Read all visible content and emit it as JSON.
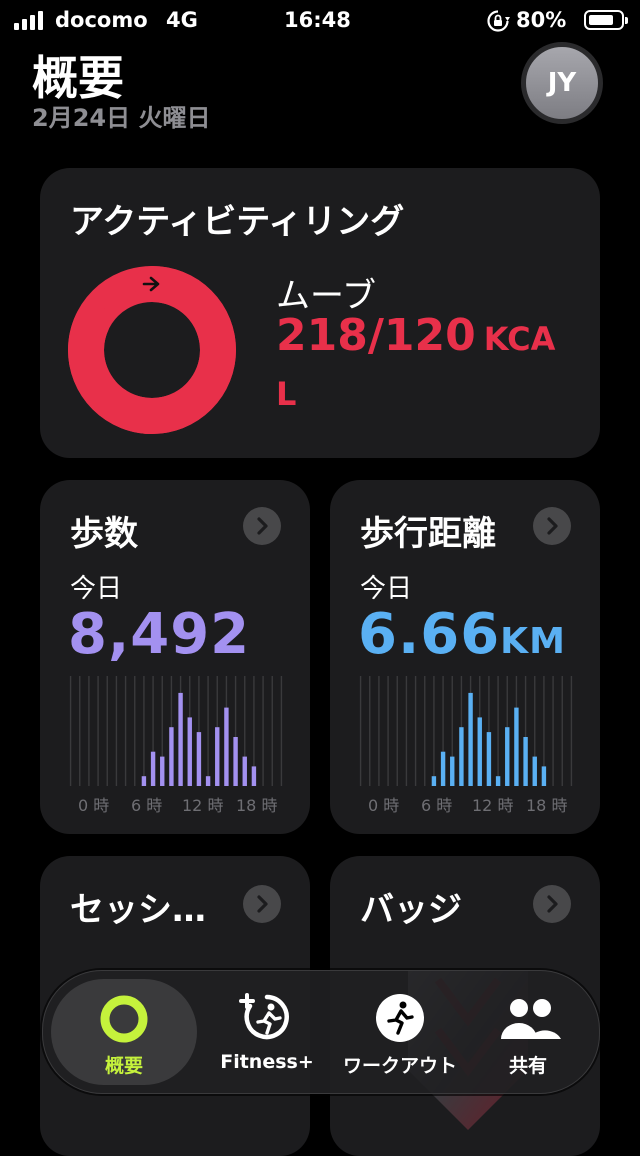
{
  "status_bar": {
    "carrier": "docomo",
    "network": "4G",
    "time": "16:48",
    "battery_percent": "80%",
    "battery_level": 0.8
  },
  "header": {
    "title": "概要",
    "date": "2月24日 火曜日",
    "avatar_initials": "JY"
  },
  "activity_card": {
    "title": "アクティビティリング",
    "move_label": "ムーブ",
    "move_value": "218/120",
    "move_unit_1": "KCA",
    "move_unit_2": "L",
    "move_progress": 1.82,
    "ring_color": "#e8304a"
  },
  "steps_card": {
    "title": "歩数",
    "period": "今日",
    "value": "8,492",
    "bar_color": "#a391f0",
    "axis": [
      "0 時",
      "6 時",
      "12 時",
      "18 時"
    ],
    "hourly_relative": [
      0,
      0,
      0,
      0,
      0,
      0,
      0,
      0,
      0.1,
      0.35,
      0.3,
      0.6,
      0.95,
      0.7,
      0.55,
      0.1,
      0.6,
      0.8,
      0.5,
      0.3,
      0.2,
      0,
      0,
      0
    ]
  },
  "distance_card": {
    "title": "歩行距離",
    "period": "今日",
    "value": "6.66",
    "unit": "KM",
    "bar_color": "#5ab0f3",
    "axis": [
      "0 時",
      "6 時",
      "12 時",
      "18 時"
    ],
    "hourly_relative": [
      0,
      0,
      0,
      0,
      0,
      0,
      0,
      0,
      0.1,
      0.35,
      0.3,
      0.6,
      0.95,
      0.7,
      0.55,
      0.1,
      0.6,
      0.8,
      0.5,
      0.3,
      0.2,
      0,
      0,
      0
    ]
  },
  "sessions_card": {
    "title": "セッシ…"
  },
  "badges_card": {
    "title": "バッジ"
  },
  "tab_bar": {
    "tabs": [
      {
        "label": "概要",
        "icon": "activity-ring-icon",
        "active": true,
        "color": "#c5f23c"
      },
      {
        "label": "Fitness+",
        "icon": "fitness-plus-icon",
        "active": false
      },
      {
        "label": "ワークアウト",
        "icon": "workout-runner-icon",
        "active": false
      },
      {
        "label": "共有",
        "icon": "sharing-people-icon",
        "active": false
      }
    ]
  }
}
